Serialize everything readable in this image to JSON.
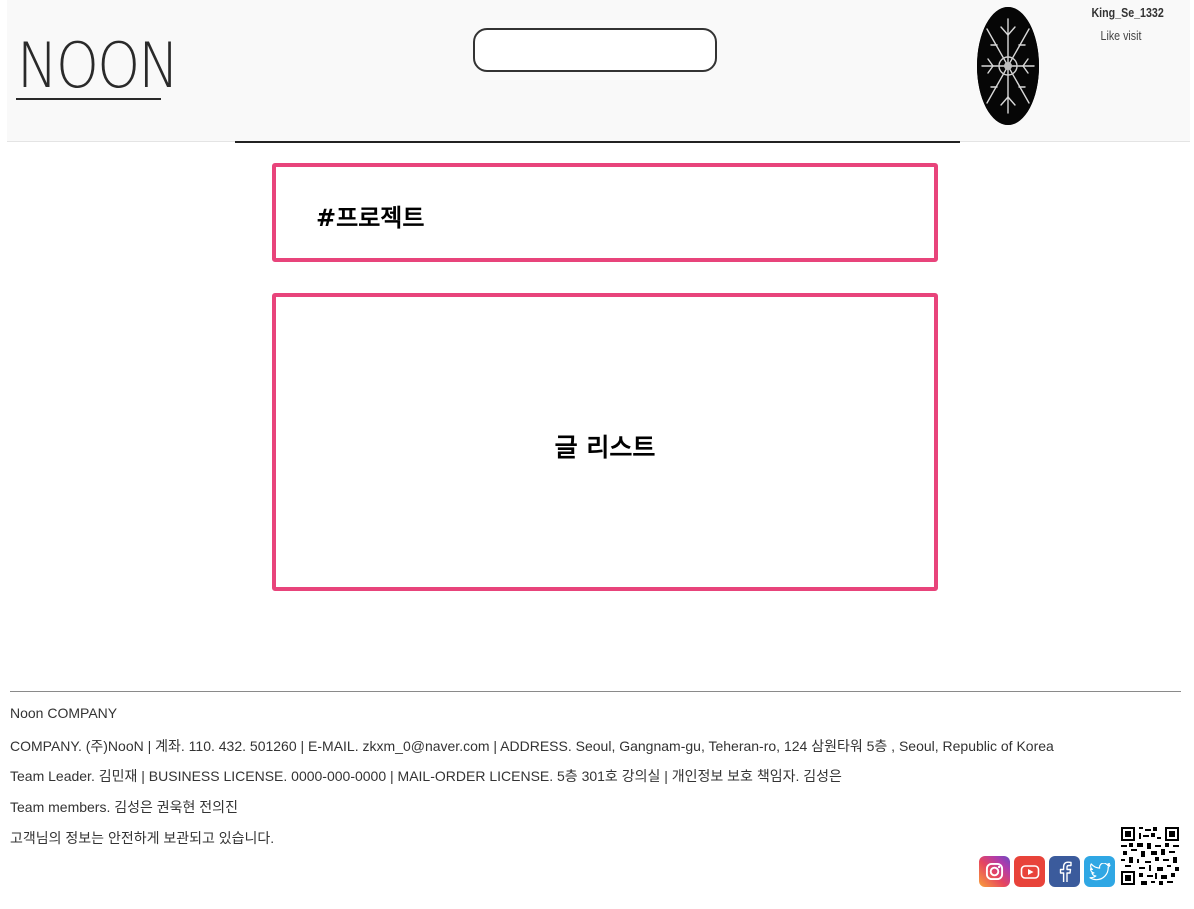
{
  "header": {
    "logo_text": "NOON",
    "search_placeholder": "",
    "username": "King_Se_1332",
    "like_visit": "Like visit"
  },
  "sections": {
    "project_title": "#프로젝트",
    "post_list_title": "글 리스트"
  },
  "footer": {
    "lines": [
      "Noon COMPANY",
      "COMPANY. (주)NooN | 계좌. 110. 432. 501260 | E-MAIL. zkxm_0@naver.com | ADDRESS. Seoul, Gangnam-gu, Teheran-ro, 124 삼원타워 5층 , Seoul, Republic of Korea",
      "Team Leader. 김민재 | BUSINESS LICENSE. 0000-000-0000 | MAIL-ORDER LICENSE. 5층 301호 강의실 | 개인정보 보호 책임자. 김성은",
      "Team members. 김성은 권욱현 전의진",
      "고객님의 정보는 안전하게 보관되고 있습니다."
    ],
    "social_icons": [
      "instagram-icon",
      "youtube-icon",
      "facebook-icon",
      "twitter-icon"
    ]
  },
  "colors": {
    "accent_border": "#e8447b",
    "header_bg": "#f9f9f9",
    "instagram": "#e6455f",
    "youtube": "#e8433a",
    "facebook": "#3b5b9c",
    "twitter": "#2fa7e4"
  }
}
